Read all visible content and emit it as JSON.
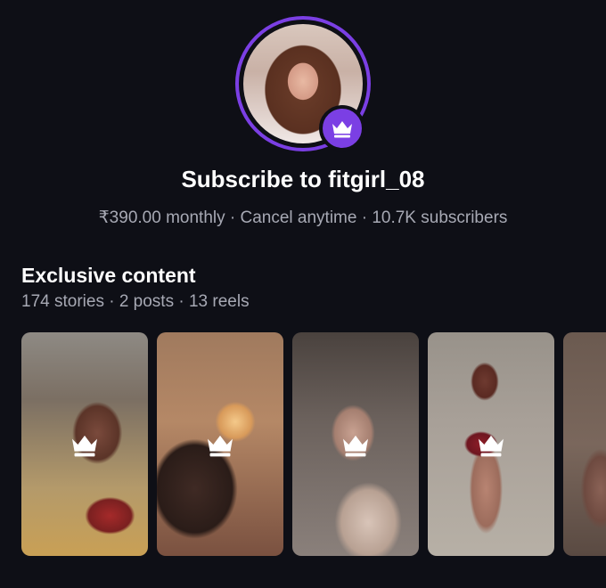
{
  "profile": {
    "title": "Subscribe to fitgirl_08",
    "subtitle": "₹390.00 monthly · Cancel anytime · 10.7K subscribers",
    "accent_color": "#7b3fe4",
    "badge_icon": "crown-icon"
  },
  "content": {
    "heading": "Exclusive content",
    "summary": "174 stories · 2 posts · 13 reels",
    "tiles": [
      {
        "icon": "crown-icon",
        "locked": true
      },
      {
        "icon": "crown-icon",
        "locked": true
      },
      {
        "icon": "crown-icon",
        "locked": true
      },
      {
        "icon": "crown-icon",
        "locked": true
      },
      {
        "icon": "crown-icon",
        "locked": true
      }
    ]
  }
}
